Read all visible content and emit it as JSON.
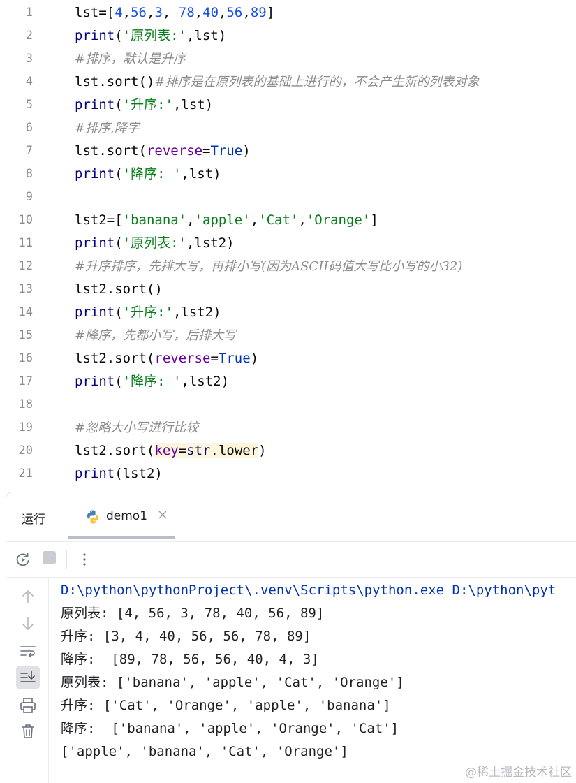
{
  "editor": {
    "line_numbers": [
      "1",
      "2",
      "3",
      "4",
      "5",
      "6",
      "7",
      "8",
      "9",
      "10",
      "11",
      "12",
      "13",
      "14",
      "15",
      "16",
      "17",
      "18",
      "19",
      "20",
      "21"
    ],
    "lines": [
      [
        {
          "t": "lst=[",
          "c": ""
        },
        {
          "t": "4",
          "c": "num"
        },
        {
          "t": ",",
          "c": ""
        },
        {
          "t": "56",
          "c": "num"
        },
        {
          "t": ",",
          "c": ""
        },
        {
          "t": "3",
          "c": "num"
        },
        {
          "t": ", ",
          "c": ""
        },
        {
          "t": "78",
          "c": "num"
        },
        {
          "t": ",",
          "c": ""
        },
        {
          "t": "40",
          "c": "num"
        },
        {
          "t": ",",
          "c": ""
        },
        {
          "t": "56",
          "c": "num"
        },
        {
          "t": ",",
          "c": ""
        },
        {
          "t": "89",
          "c": "num"
        },
        {
          "t": "]",
          "c": ""
        }
      ],
      [
        {
          "t": "print",
          "c": "kw"
        },
        {
          "t": "(",
          "c": ""
        },
        {
          "t": "'原列表:'",
          "c": "str"
        },
        {
          "t": ",lst)",
          "c": ""
        }
      ],
      [
        {
          "t": "#排序，默认是升序",
          "c": "cmt"
        }
      ],
      [
        {
          "t": "lst.sort()",
          "c": ""
        },
        {
          "t": "#排序是在原列表的基础上进行的，不会产生新的列表对象",
          "c": "cmt"
        }
      ],
      [
        {
          "t": "print",
          "c": "kw"
        },
        {
          "t": "(",
          "c": ""
        },
        {
          "t": "'升序:'",
          "c": "str"
        },
        {
          "t": ",lst)",
          "c": ""
        }
      ],
      [
        {
          "t": "#排序,降字",
          "c": "cmt"
        }
      ],
      [
        {
          "t": "lst.sort(",
          "c": ""
        },
        {
          "t": "reverse",
          "c": "kwarg"
        },
        {
          "t": "=",
          "c": ""
        },
        {
          "t": "True",
          "c": "const"
        },
        {
          "t": ")",
          "c": ""
        }
      ],
      [
        {
          "t": "print",
          "c": "kw"
        },
        {
          "t": "(",
          "c": ""
        },
        {
          "t": "'降序: '",
          "c": "str"
        },
        {
          "t": ",lst)",
          "c": ""
        }
      ],
      [],
      [
        {
          "t": "lst2=[",
          "c": ""
        },
        {
          "t": "'banana'",
          "c": "str"
        },
        {
          "t": ",",
          "c": ""
        },
        {
          "t": "'apple'",
          "c": "str"
        },
        {
          "t": ",",
          "c": ""
        },
        {
          "t": "'Cat'",
          "c": "str"
        },
        {
          "t": ",",
          "c": ""
        },
        {
          "t": "'Orange'",
          "c": "str"
        },
        {
          "t": "]",
          "c": ""
        }
      ],
      [
        {
          "t": "print",
          "c": "kw"
        },
        {
          "t": "(",
          "c": ""
        },
        {
          "t": "'原列表:'",
          "c": "str"
        },
        {
          "t": ",lst2)",
          "c": ""
        }
      ],
      [
        {
          "t": "#升序排序，先排大写，再排小写(因为ASCII码值大写比小写的小32)",
          "c": "cmt"
        }
      ],
      [
        {
          "t": "lst2.sort()",
          "c": ""
        }
      ],
      [
        {
          "t": "print",
          "c": "kw"
        },
        {
          "t": "(",
          "c": ""
        },
        {
          "t": "'升序:'",
          "c": "str"
        },
        {
          "t": ",lst2)",
          "c": ""
        }
      ],
      [
        {
          "t": "#降序，先都小写，后排大写",
          "c": "cmt"
        }
      ],
      [
        {
          "t": "lst2.sort(",
          "c": ""
        },
        {
          "t": "reverse",
          "c": "kwarg"
        },
        {
          "t": "=",
          "c": ""
        },
        {
          "t": "True",
          "c": "const"
        },
        {
          "t": ")",
          "c": ""
        }
      ],
      [
        {
          "t": "print",
          "c": "kw"
        },
        {
          "t": "(",
          "c": ""
        },
        {
          "t": "'降序: '",
          "c": "str"
        },
        {
          "t": ",lst2)",
          "c": ""
        }
      ],
      [],
      [
        {
          "t": "#忽略大小写进行比较",
          "c": "cmt"
        }
      ],
      [
        {
          "t": "lst2.sort(",
          "c": ""
        },
        {
          "t": "key",
          "c": "kwarg keyhl"
        },
        {
          "t": "=",
          "c": "keyhl"
        },
        {
          "t": "str",
          "c": "kw keyhl"
        },
        {
          "t": ".lower",
          "c": "keyhl"
        },
        {
          "t": ")",
          "c": ""
        }
      ],
      [
        {
          "t": "print",
          "c": "kw"
        },
        {
          "t": "(lst2)",
          "c": ""
        }
      ]
    ]
  },
  "run_panel": {
    "title": "运行",
    "tab_label": "demo1",
    "close_symbol": "×",
    "console_lines": [
      "D:\\python\\pythonProject\\.venv\\Scripts\\python.exe D:\\python\\pyt",
      "原列表: [4, 56, 3, 78, 40, 56, 89]",
      "升序: [3, 4, 40, 56, 56, 78, 89]",
      "降序:  [89, 78, 56, 56, 40, 4, 3]",
      "原列表: ['banana', 'apple', 'Cat', 'Orange']",
      "升序: ['Cat', 'Orange', 'apple', 'banana']",
      "降序:  ['banana', 'apple', 'Orange', 'Cat']",
      "['apple', 'banana', 'Cat', 'Orange']"
    ]
  },
  "watermark": "@稀土掘金技术社区",
  "colors": {
    "keyword": "#000080",
    "number": "#1750eb",
    "string": "#067d17",
    "kwarg": "#660099",
    "constant": "#0033b3",
    "comment": "#8c8c8c",
    "key_highlight": "#fdf6dc"
  }
}
